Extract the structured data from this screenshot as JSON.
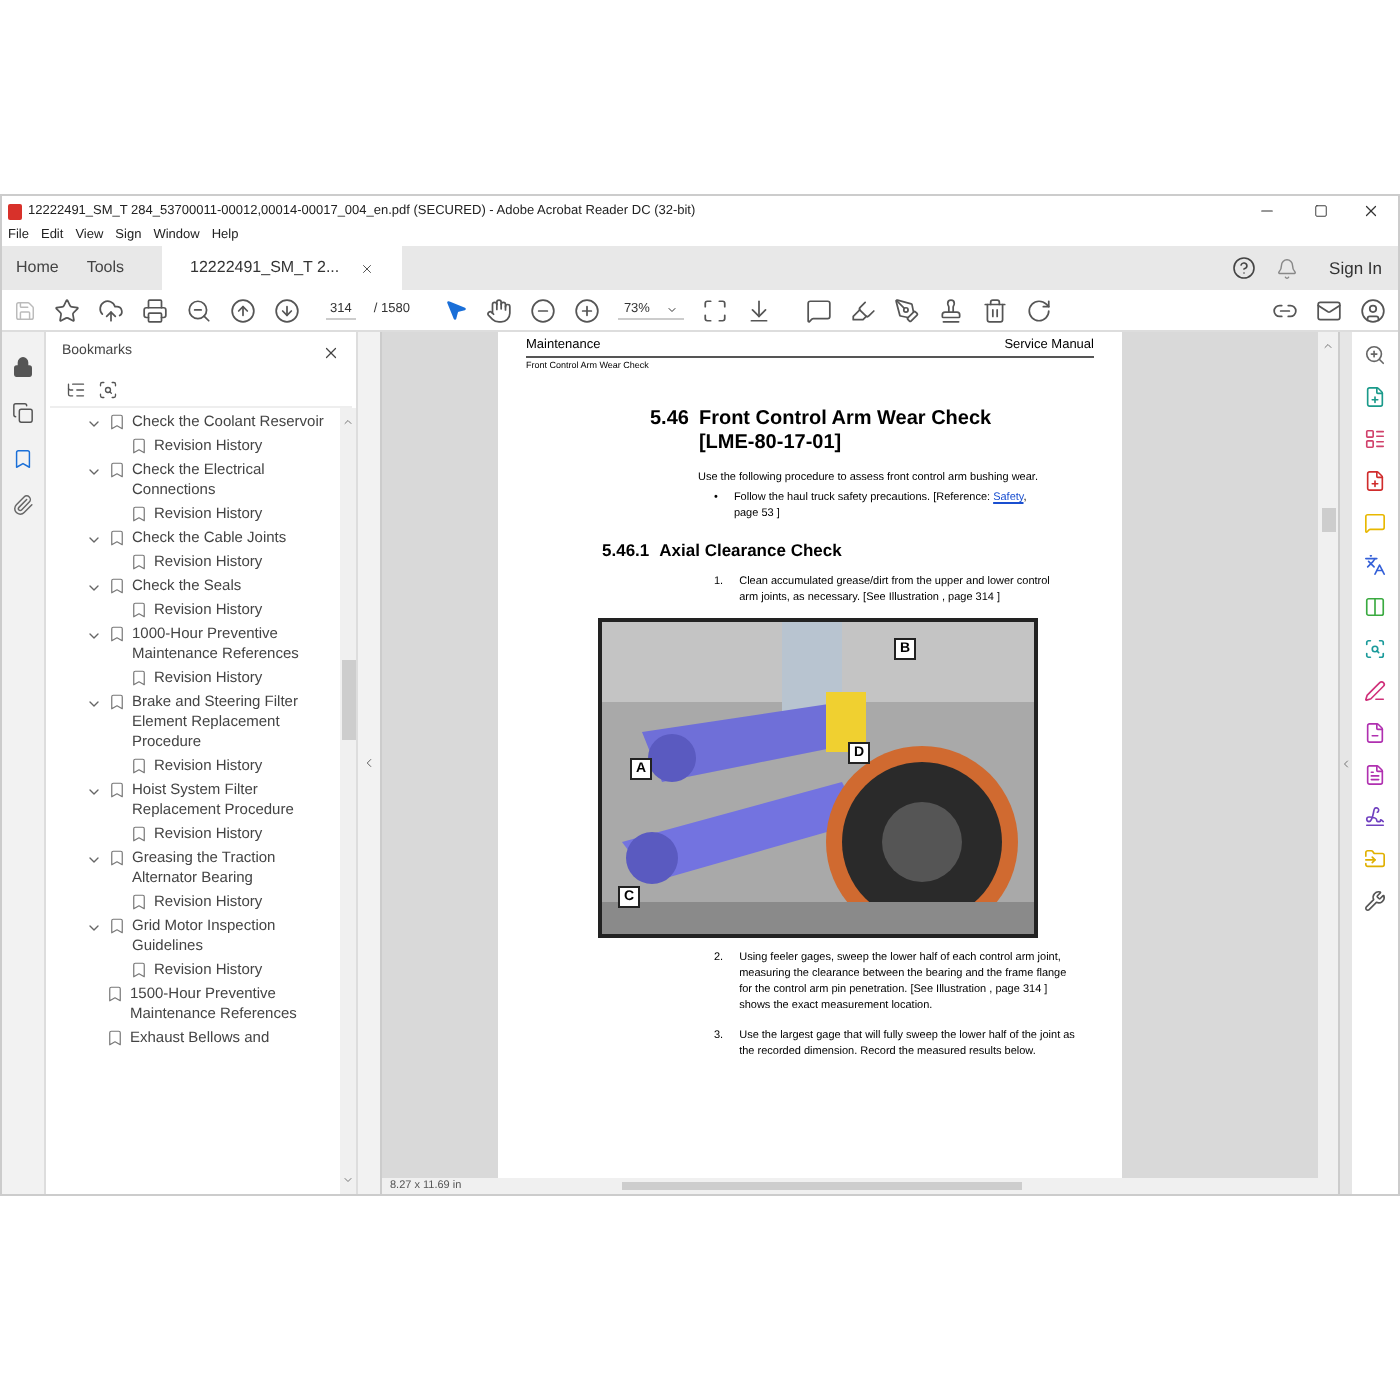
{
  "window": {
    "title": "12222491_SM_T 284_53700011-00012,00014-00017_004_en.pdf (SECURED) - Adobe Acrobat Reader DC (32-bit)"
  },
  "menu": [
    "File",
    "Edit",
    "View",
    "Sign",
    "Window",
    "Help"
  ],
  "tabs": [
    {
      "label": "Home",
      "selected": false,
      "kind": "nav"
    },
    {
      "label": "Tools",
      "selected": false,
      "kind": "nav"
    },
    {
      "label": "12222491_SM_T 2...",
      "selected": true,
      "kind": "document"
    }
  ],
  "sign_in": "Sign In",
  "toolbar": {
    "page": "314",
    "page_total": "/ 1580",
    "zoom": "73%"
  },
  "sidebar": {
    "title": "Bookmarks",
    "items": [
      {
        "label": "Check the Coolant Reservoir",
        "expanded": true,
        "children": [
          {
            "label": "Revision History"
          }
        ]
      },
      {
        "label": "Check the Electrical Connections",
        "expanded": true,
        "children": [
          {
            "label": "Revision History"
          }
        ]
      },
      {
        "label": "Check the Cable Joints",
        "expanded": true,
        "children": [
          {
            "label": "Revision History"
          }
        ]
      },
      {
        "label": "Check the Seals",
        "expanded": true,
        "children": [
          {
            "label": "Revision History"
          }
        ]
      },
      {
        "label": "1000-Hour Preventive Maintenance References",
        "expanded": true,
        "children": [
          {
            "label": "Revision History"
          }
        ]
      },
      {
        "label": "Brake and Steering Filter Element Replacement Procedure",
        "expanded": true,
        "children": [
          {
            "label": "Revision History"
          }
        ]
      },
      {
        "label": "Hoist System Filter Replacement Procedure",
        "expanded": true,
        "children": [
          {
            "label": "Revision History"
          }
        ]
      },
      {
        "label": "Greasing the Traction Alternator Bearing",
        "expanded": true,
        "children": [
          {
            "label": "Revision History"
          }
        ]
      },
      {
        "label": "Grid Motor Inspection Guidelines",
        "expanded": true,
        "children": [
          {
            "label": "Revision History"
          }
        ]
      },
      {
        "label": "1500-Hour Preventive Maintenance References"
      },
      {
        "label": "Exhaust Bellows and"
      }
    ]
  },
  "page": {
    "header_left": "Maintenance",
    "header_right": "Service Manual",
    "subheader": "Front Control Arm Wear Check",
    "heading_number": "5.46",
    "heading": "Front Control Arm Wear Check [LME-80-17-01]",
    "intro": "Use the following procedure to assess front control arm bushing wear.",
    "bullet": {
      "mark": "•",
      "before": "Follow the haul truck safety precautions. [Reference: ",
      "link": "Safety",
      "after": ", page  53 ]"
    },
    "subheading_number": "5.46.1",
    "subheading": "Axial Clearance Check",
    "steps": [
      {
        "number": "1.",
        "text": "Clean accumulated grease/dirt from the upper and lower control arm joints, as necessary. [See Illustration , page  314 ]"
      }
    ],
    "figure": {
      "kind": "picture",
      "callouts": [
        "A",
        "B",
        "C",
        "D"
      ]
    },
    "steps_after": [
      {
        "number": "2.",
        "text": "Using feeler gages, sweep the lower half of each control arm joint, measuring the clearance between the bearing and the frame flange for the control arm pin penetration. [See Illustration , page  314 ] shows the exact measurement location."
      },
      {
        "number": "3.",
        "text": "Use the largest gage that will fully sweep the lower half of the joint as the recorded dimension. Record the measured results below."
      }
    ]
  },
  "status_bar": {
    "page_size": "8.27 x 11.69 in"
  }
}
